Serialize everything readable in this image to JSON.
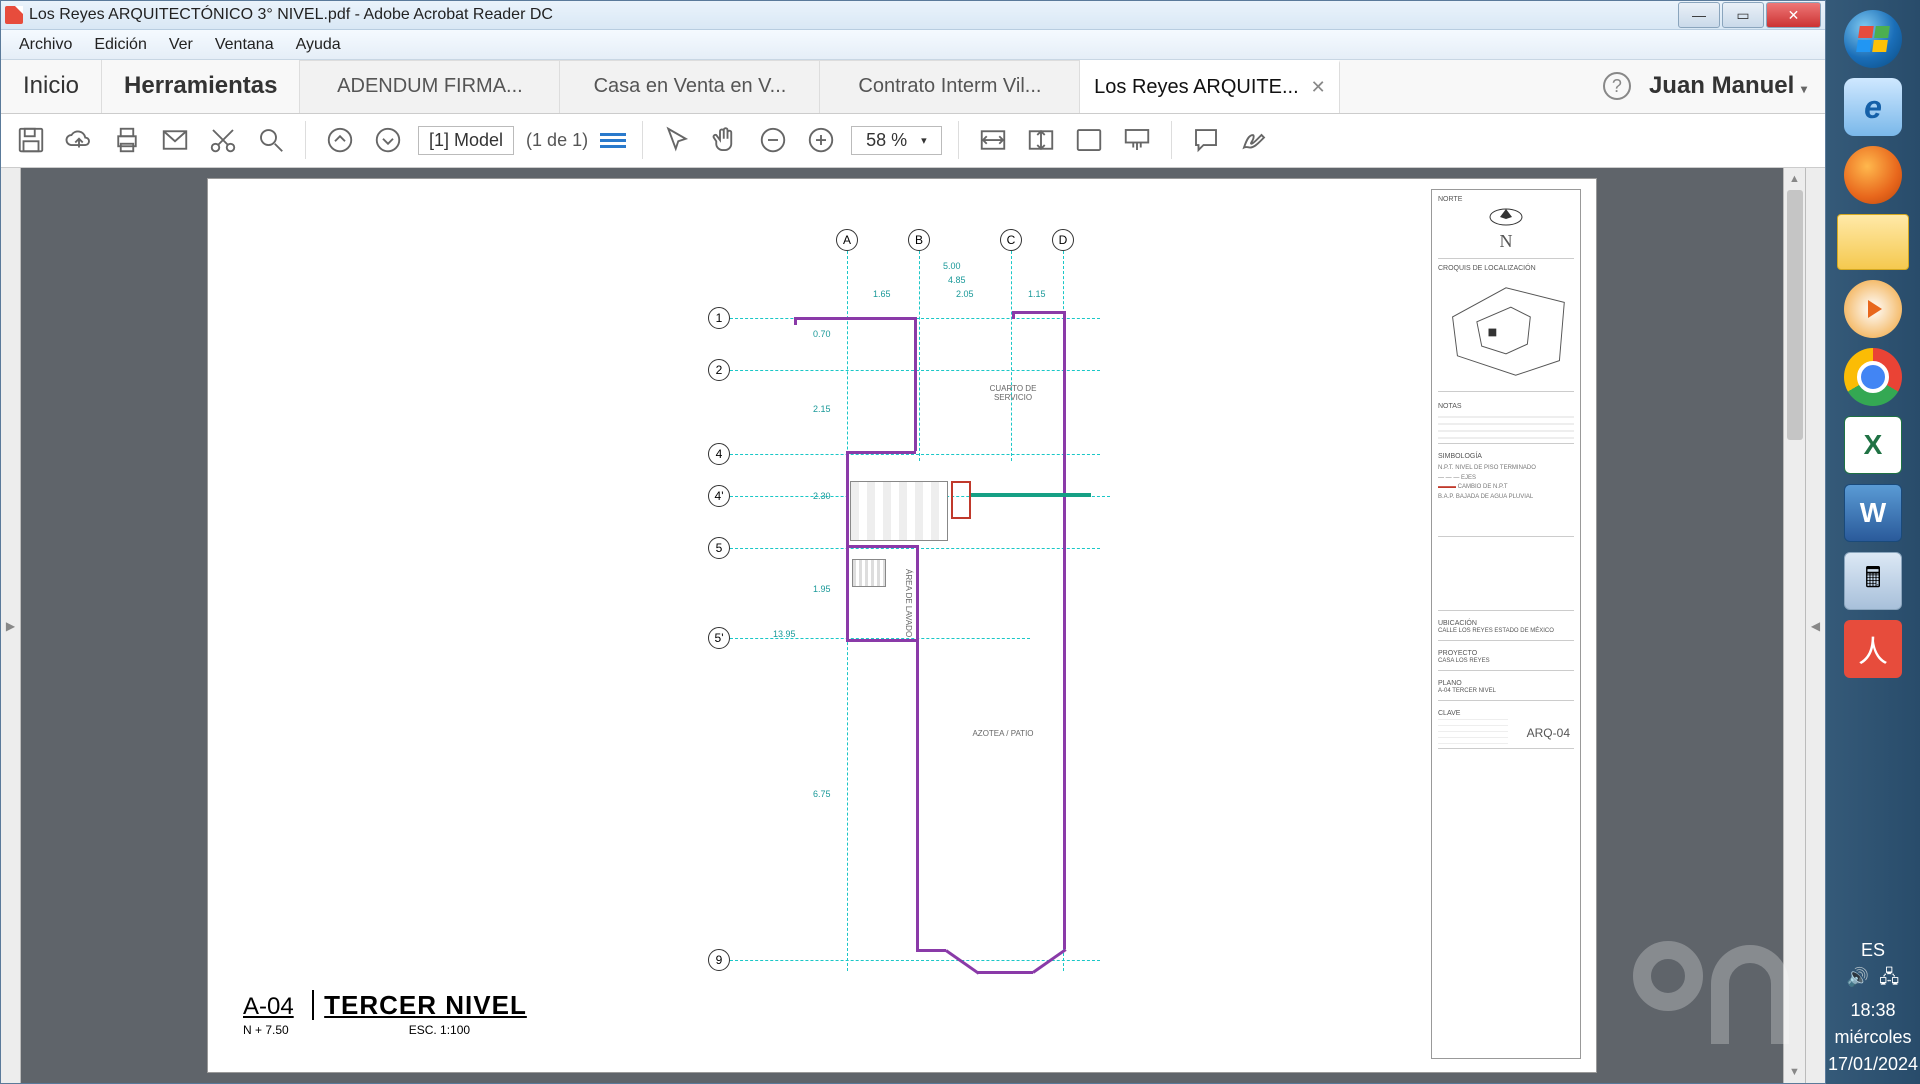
{
  "window": {
    "title": "Los Reyes ARQUITECTÓNICO 3° NIVEL.pdf - Adobe Acrobat Reader DC"
  },
  "menu": {
    "archivo": "Archivo",
    "edicion": "Edición",
    "ver": "Ver",
    "ventana": "Ventana",
    "ayuda": "Ayuda"
  },
  "tabs": {
    "inicio": "Inicio",
    "herramientas": "Herramientas",
    "items": [
      {
        "label": "ADENDUM FIRMA..."
      },
      {
        "label": "Casa en Venta en V..."
      },
      {
        "label": "Contrato Interm Vil..."
      },
      {
        "label": "Los Reyes ARQUITE..."
      }
    ]
  },
  "user": {
    "name": "Juan Manuel"
  },
  "toolbar": {
    "page_label": "[1] Model",
    "page_count": "(1 de 1)",
    "zoom": "58 %"
  },
  "plan": {
    "sheet": "A-04",
    "title": "TERCER NIVEL",
    "level": "N + 7.50",
    "scale": "ESC. 1:100",
    "cols": [
      "A",
      "B",
      "C",
      "D"
    ],
    "rows": [
      "1",
      "2",
      "4",
      "4'",
      "5",
      "5'",
      "9"
    ],
    "dims": {
      "top1": "5.00",
      "top2": "4.85",
      "top3": "1.65",
      "top4": "2.05",
      "top5": "1.15",
      "d070": "0.70",
      "d215": "2.15",
      "d230": "2.30",
      "d195": "1.95",
      "d1395": "13.95",
      "d675": "6.75"
    },
    "rooms": {
      "cuarto": "CUARTO DE SERVICIO",
      "lavado": "ÁREA DE LAVADO",
      "azotea": "AZOTEA / PATIO"
    },
    "side": {
      "norte": "NORTE",
      "croquis": "CROQUIS DE LOCALIZACIÓN",
      "n": "N",
      "notas": "NOTAS",
      "simbologia": "SIMBOLOGÍA",
      "ubicacion": "UBICACIÓN",
      "ubicacion_val": "CALLE    LOS REYES ESTADO DE MÉXICO",
      "proyecto": "PROYECTO",
      "proyecto_val": "CASA LOS REYES",
      "plano": "PLANO",
      "plano_val": "A-04 TERCER NIVEL",
      "clave": "CLAVE",
      "clave_val": "ARQ-04"
    }
  },
  "systray": {
    "lang": "ES",
    "time": "18:38",
    "day": "miércoles",
    "date": "17/01/2024"
  }
}
